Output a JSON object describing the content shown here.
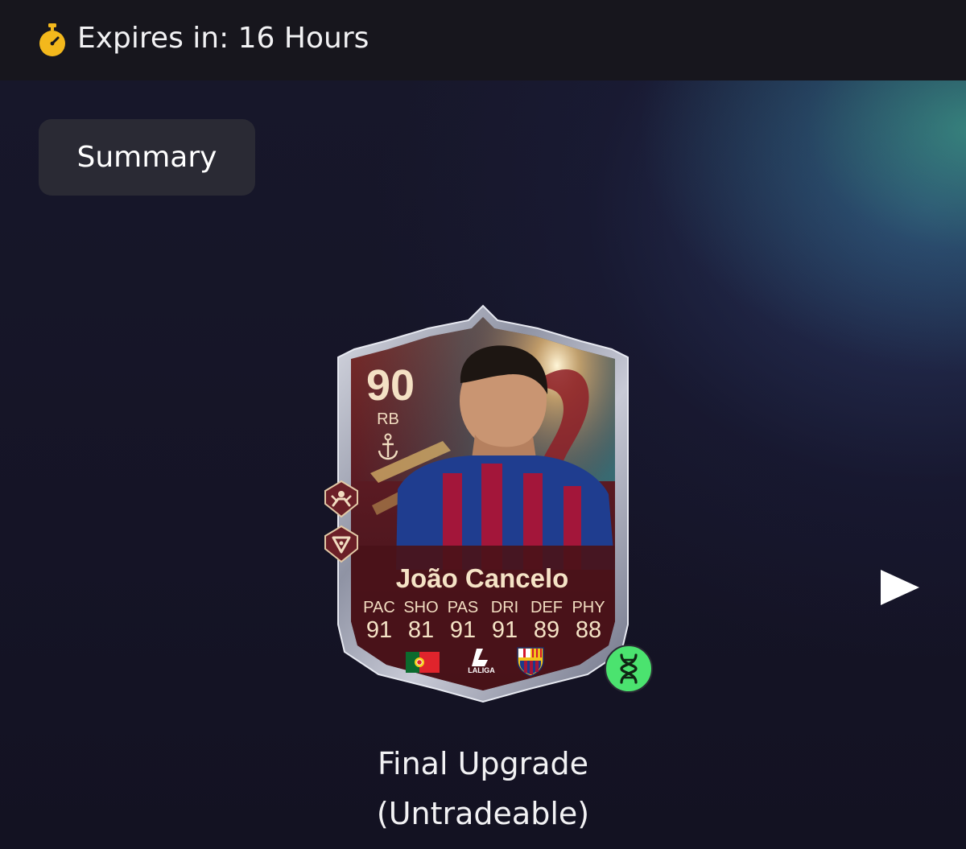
{
  "header": {
    "timer_icon": "stopwatch-icon",
    "expires_text": "Expires in: 16 Hours"
  },
  "summary_button": {
    "label": "Summary"
  },
  "card": {
    "rating": "90",
    "position": "RB",
    "name": "João Cancelo",
    "stats": [
      {
        "label": "PAC",
        "value": "91"
      },
      {
        "label": "SHO",
        "value": "81"
      },
      {
        "label": "PAS",
        "value": "91"
      },
      {
        "label": "DRI",
        "value": "91"
      },
      {
        "label": "DEF",
        "value": "89"
      },
      {
        "label": "PHY",
        "value": "88"
      }
    ],
    "league_text": "LALIGA",
    "chemistry_icon": "anchor-icon",
    "playstyle_icons": [
      "playstyle-plus-icon",
      "playstyle-plus-icon"
    ],
    "nation_icon": "portugal-flag-icon",
    "club_icon": "barcelona-crest-icon",
    "evo_icon": "dna-icon"
  },
  "item_title": {
    "line1": "Final Upgrade",
    "line2": "(Untradeable)"
  },
  "colors": {
    "accent_green": "#4be36f",
    "timer_gold": "#f3b81c",
    "card_gold_text": "#f4e1c4",
    "card_maroon": "#5a1a22"
  },
  "navigation": {
    "next_icon": "play-arrow-icon"
  }
}
